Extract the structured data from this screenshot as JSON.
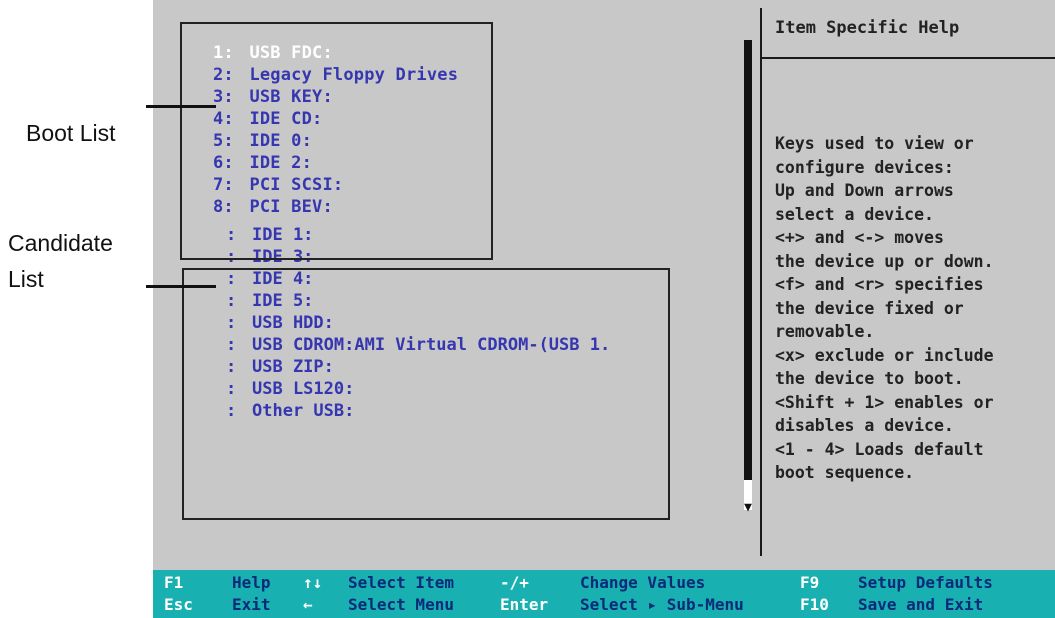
{
  "boot_list": [
    {
      "num": "1:",
      "label": "USB FDC:",
      "selected": true
    },
    {
      "num": "2:",
      "label": "Legacy Floppy Drives"
    },
    {
      "num": "3:",
      "label": "USB KEY:"
    },
    {
      "num": "4:",
      "label": "IDE CD:"
    },
    {
      "num": "5:",
      "label": "IDE 0:"
    },
    {
      "num": "6:",
      "label": "IDE 2:"
    },
    {
      "num": "7:",
      "label": "PCI SCSI:"
    },
    {
      "num": "8:",
      "label": "PCI BEV:"
    }
  ],
  "candidate_list": [
    {
      "colon": ":",
      "label": "IDE 1:"
    },
    {
      "colon": ":",
      "label": "IDE 3:"
    },
    {
      "colon": ":",
      "label": "IDE 4:"
    },
    {
      "colon": ":",
      "label": "IDE 5:"
    },
    {
      "colon": ":",
      "label": "USB HDD:"
    },
    {
      "colon": ":",
      "label": "USB CDROM:AMI Virtual CDROM-(USB 1."
    },
    {
      "colon": ":",
      "label": "USB ZIP:"
    },
    {
      "colon": ":",
      "label": "USB LS120:"
    },
    {
      "colon": ":",
      "label": "Other USB:"
    }
  ],
  "help": {
    "title": "Item Specific Help",
    "text": "Keys used to view or\nconfigure devices:\nUp and Down arrows\nselect a device.\n<+> and <-> moves\nthe device up or down.\n<f> and <r> specifies\nthe device fixed or\nremovable.\n<x> exclude or include\nthe device to boot.\n<Shift + 1> enables or\ndisables a device.\n<1 - 4> Loads default\nboot sequence."
  },
  "footer": {
    "row1": [
      {
        "key": "F1",
        "label": "Help"
      },
      {
        "key": "↑↓",
        "label": "Select Item"
      },
      {
        "key": "-/+",
        "label": "Change Values"
      },
      {
        "key": "F9",
        "label": "Setup Defaults"
      }
    ],
    "row2": [
      {
        "key": "Esc",
        "label": "Exit"
      },
      {
        "key": "←",
        "label": "Select Menu"
      },
      {
        "key": "Enter",
        "label": "Select ▸ Sub-Menu"
      },
      {
        "key": "F10",
        "label": "Save and Exit"
      }
    ]
  },
  "annotations": {
    "boot_list": "Boot List",
    "candidate_line1": "Candidate",
    "candidate_line2": "List"
  },
  "scrollbar": {
    "down_arrow": "▼"
  },
  "colors": {
    "screen_bg": "#c8c8c8",
    "item_text": "#3636b0",
    "selected_text": "#ffffff",
    "footer_bg": "#18b0b0",
    "footer_key": "#ffffff",
    "footer_label": "#0a2a7a"
  }
}
